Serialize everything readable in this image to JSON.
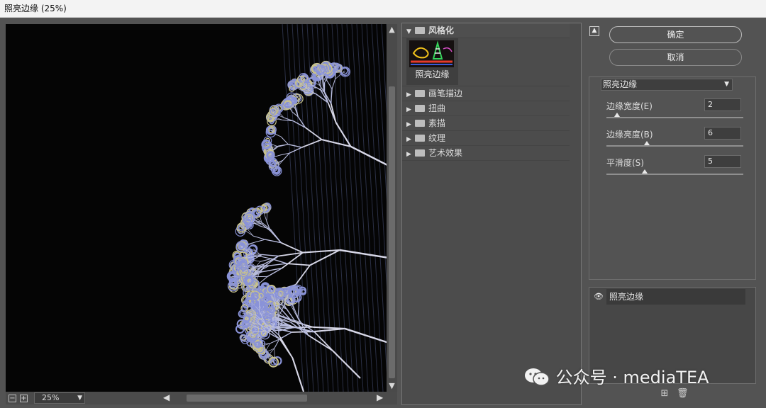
{
  "window": {
    "title": "照亮边缘 (25%)"
  },
  "preview": {
    "zoom": "25%",
    "zoom_out_icon": "minus-box-icon",
    "zoom_in_icon": "plus-box-icon"
  },
  "gallery": {
    "open_category": "风格化",
    "selected_filter": "照亮边缘",
    "categories": [
      "画笔描边",
      "扭曲",
      "素描",
      "纹理",
      "艺术效果"
    ]
  },
  "buttons": {
    "ok": "确定",
    "cancel": "取消"
  },
  "settings": {
    "filter": "照亮边缘",
    "params": [
      {
        "label": "边缘宽度(E)",
        "value": "2",
        "min": 1,
        "max": 14
      },
      {
        "label": "边缘亮度(B)",
        "value": "6",
        "min": 0,
        "max": 20
      },
      {
        "label": "平滑度(S)",
        "value": "5",
        "min": 1,
        "max": 15
      }
    ]
  },
  "layers": {
    "items": [
      {
        "name": "照亮边缘"
      }
    ]
  },
  "watermark": {
    "text": "公众号 · mediaTEA"
  }
}
